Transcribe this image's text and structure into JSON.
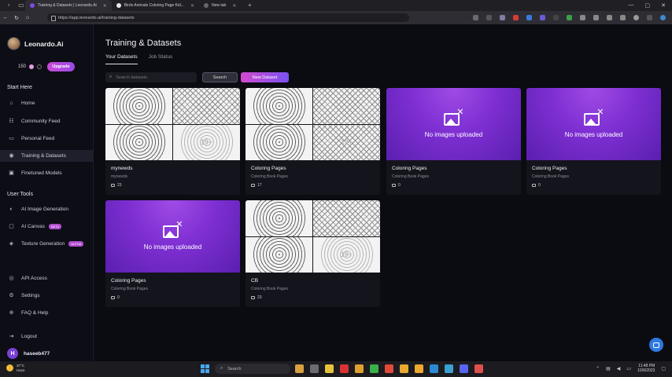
{
  "browser": {
    "tabs": [
      {
        "label": "Training & Datasets | Leonardo.Ai",
        "active": true,
        "color": "#7c4ddb"
      },
      {
        "label": "Birds Animals Coloring Page Kid...",
        "active": false,
        "color": "#e8e8e8"
      },
      {
        "label": "New tab",
        "active": false,
        "color": "#666666"
      }
    ],
    "url": "https://app.leonardo.ai/training-datasets"
  },
  "sidebar": {
    "brand": "Leonardo.Ai",
    "tokens": "150",
    "upgrade_label": "Upgrade",
    "start_title": "Start Here",
    "start_items": [
      {
        "label": "Home",
        "icon": "home-icon",
        "glyph": "⌂"
      },
      {
        "label": "Community Feed",
        "icon": "community-icon",
        "glyph": "☷"
      },
      {
        "label": "Personal Feed",
        "icon": "personal-feed-icon",
        "glyph": "▭"
      },
      {
        "label": "Training & Datasets",
        "icon": "training-icon",
        "glyph": "◉"
      },
      {
        "label": "Finetuned Models",
        "icon": "models-icon",
        "glyph": "▣"
      }
    ],
    "tools_title": "User Tools",
    "tool_items": [
      {
        "label": "AI Image Generation",
        "icon": "image-gen-icon",
        "glyph": "◐",
        "badge": ""
      },
      {
        "label": "AI Canvas",
        "icon": "canvas-icon",
        "glyph": "▢",
        "badge": "BETA"
      },
      {
        "label": "Texture Generation",
        "icon": "texture-icon",
        "glyph": "◈",
        "badge": "ALPHA"
      }
    ],
    "bottom_items": [
      {
        "label": "API Access",
        "icon": "api-icon",
        "glyph": "◎"
      },
      {
        "label": "Settings",
        "icon": "settings-icon",
        "glyph": "⚙"
      },
      {
        "label": "FAQ & Help",
        "icon": "help-icon",
        "glyph": "⊕"
      },
      {
        "label": "Logout",
        "icon": "logout-icon",
        "glyph": "⇥"
      }
    ],
    "user": {
      "initial": "H",
      "name": "haseeb477"
    }
  },
  "main": {
    "title": "Training & Datasets",
    "tabs": [
      "Your Datasets",
      "Job Status"
    ],
    "search_placeholder": "Search datasets",
    "search_label": "Search",
    "new_label": "New Dataset",
    "empty_label": "No images uploaded",
    "more_label": "19+",
    "cards": [
      {
        "title": "mynewds",
        "subtitle": "mynewds",
        "count": "23",
        "images": true
      },
      {
        "title": "Coloring Pages",
        "subtitle": "Coloring Book Pages",
        "count": "17",
        "images": true
      },
      {
        "title": "Coloring Pages",
        "subtitle": "Coloring Book Pages",
        "count": "0",
        "images": false
      },
      {
        "title": "Coloring Pages",
        "subtitle": "Coloring Book Pages",
        "count": "0",
        "images": false
      },
      {
        "title": "Coloring Pages",
        "subtitle": "Coloring Book Pages",
        "count": "0",
        "images": false
      },
      {
        "title": "CB",
        "subtitle": "Coloring Book Pages",
        "count": "23",
        "images": true
      }
    ]
  },
  "taskbar": {
    "weather_temp": "37°C",
    "weather_desc": "Haze",
    "search_label": "Search",
    "time": "11:48 PM",
    "date": "10/9/2023",
    "app_colors": [
      "#d8a040",
      "#6b6b70",
      "#e6c43a",
      "#d83232",
      "#e0a030",
      "#3ab04a",
      "#e04a3a",
      "#e8a830",
      "#f0a830",
      "#2a8ad0",
      "#3aa0d0",
      "#5865f2",
      "#e0504a"
    ]
  }
}
